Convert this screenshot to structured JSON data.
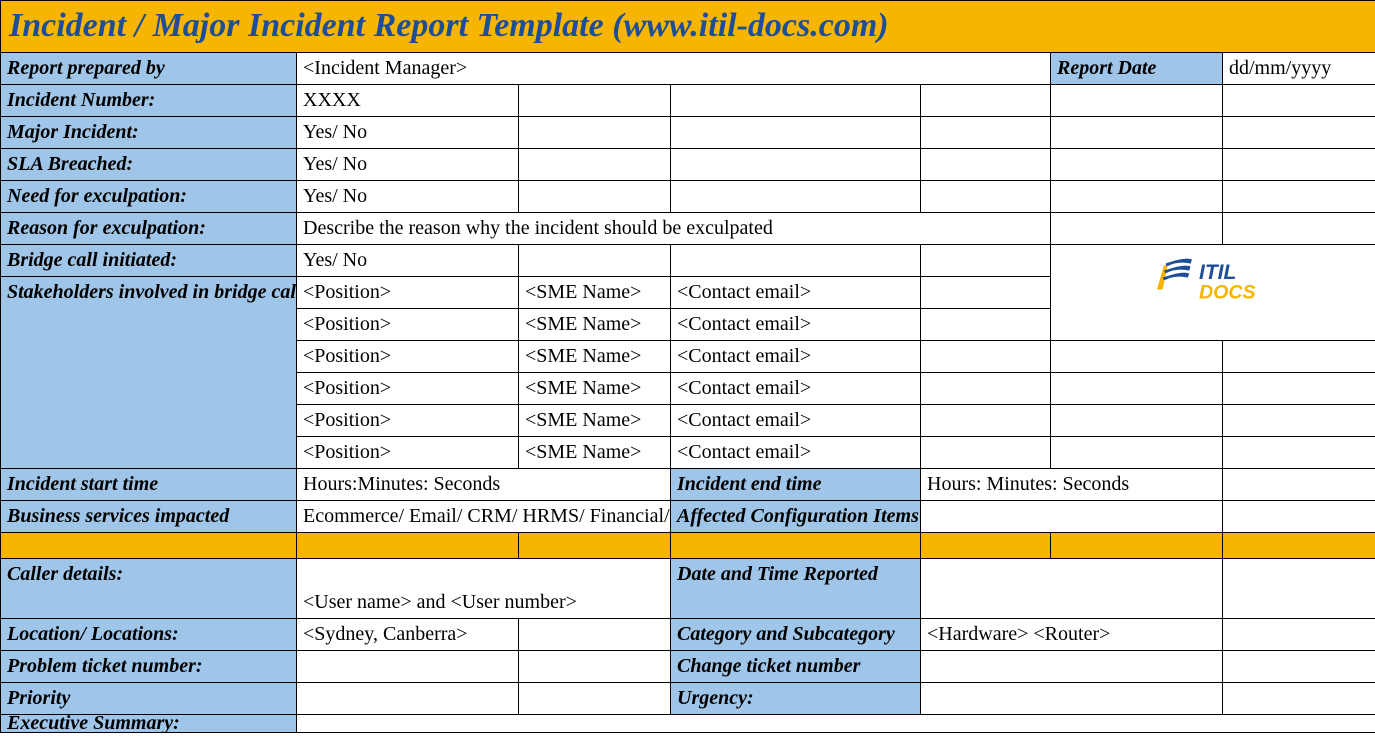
{
  "title": "Incident / Major Incident Report Template   (www.itil-docs.com)",
  "labels": {
    "reportPreparedBy": "Report prepared by",
    "reportDate": "Report Date",
    "incidentNumber": "Incident Number:",
    "majorIncident": "Major Incident:",
    "slaBreached": "SLA Breached:",
    "needExculpation": "Need for exculpation:",
    "reasonExculpation": "Reason for exculpation:",
    "bridgeCall": "Bridge call initiated:",
    "stakeholders": "Stakeholders involved in bridge call:",
    "incidentStart": "Incident start time",
    "incidentEnd": "Incident end time",
    "businessServices": "Business services impacted",
    "affectedCI": "Affected Configuration Items",
    "callerDetails": "Caller details:",
    "dateTimeReported": "Date and Time Reported",
    "locations": "Location/ Locations:",
    "categorySubcat": "Category and Subcategory",
    "problemTicket": "Problem ticket number:",
    "changeTicket": "Change ticket number",
    "priority": "Priority",
    "urgency": "Urgency:",
    "execSummary": "Executive Summary:"
  },
  "values": {
    "reportPreparedBy": "<Incident Manager>",
    "reportDate": "dd/mm/yyyy",
    "incidentNumber": "XXXX",
    "majorIncident": "Yes/ No",
    "slaBreached": "Yes/ No",
    "needExculpation": "Yes/ No",
    "reasonExculpation": "Describe the reason why the incident should be exculpated",
    "bridgeCall": "Yes/ No",
    "incidentStart": "Hours:Minutes: Seconds",
    "incidentEnd": "Hours: Minutes: Seconds",
    "businessServices": "Ecommerce/ Email/ CRM/ HRMS/ Financial/ etc.",
    "callerDetails": "<User name> and <User number>",
    "locations": "<Sydney, Canberra>",
    "categorySubcat": "<Hardware> <Router>"
  },
  "stakeholders": [
    {
      "position": "<Position>",
      "sme": "<SME Name>",
      "email": "<Contact email>"
    },
    {
      "position": "<Position>",
      "sme": "<SME Name>",
      "email": "<Contact email>"
    },
    {
      "position": "<Position>",
      "sme": "<SME Name>",
      "email": "<Contact email>"
    },
    {
      "position": "<Position>",
      "sme": "<SME Name>",
      "email": "<Contact email>"
    },
    {
      "position": "<Position>",
      "sme": "<SME Name>",
      "email": "<Contact email>"
    },
    {
      "position": "<Position>",
      "sme": "<SME Name>",
      "email": "<Contact email>"
    }
  ],
  "logo": {
    "textItil": "ITIL",
    "textDocs": "DOCS"
  }
}
